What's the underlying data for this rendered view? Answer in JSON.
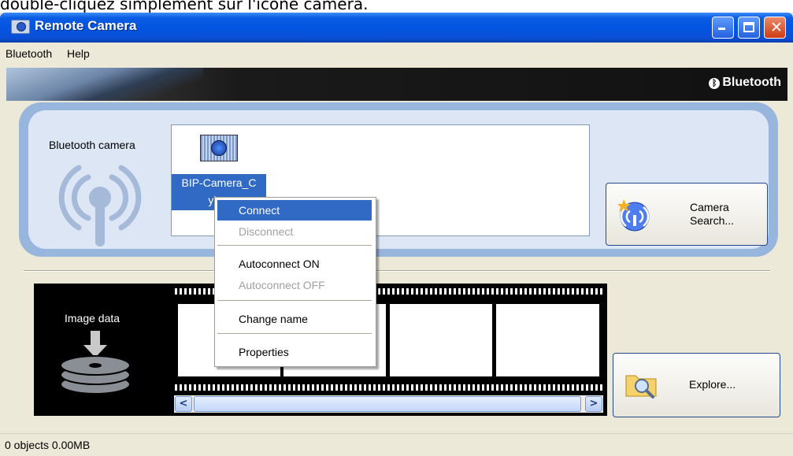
{
  "caption": "double-cliquez simplement sur l'icône caméra.",
  "window": {
    "title": "Remote Camera"
  },
  "menubar": {
    "items": [
      "Bluetooth",
      "Help"
    ]
  },
  "banner": {
    "logo_text": "Bluetooth"
  },
  "camera_section": {
    "label": "Bluetooth camera",
    "device_name_line1": "BIP-Camera_C",
    "device_name_line2": "yber"
  },
  "camera_search_button": {
    "line1": "Camera",
    "line2": "Search..."
  },
  "image_section": {
    "label": "Image data"
  },
  "explore_button": {
    "label": "Explore..."
  },
  "context_menu": {
    "items": [
      "Connect",
      "Disconnect",
      "Autoconnect ON",
      "Autoconnect OFF",
      "Change name",
      "Properties"
    ]
  },
  "status": {
    "text": "0 objects 0.00MB"
  }
}
